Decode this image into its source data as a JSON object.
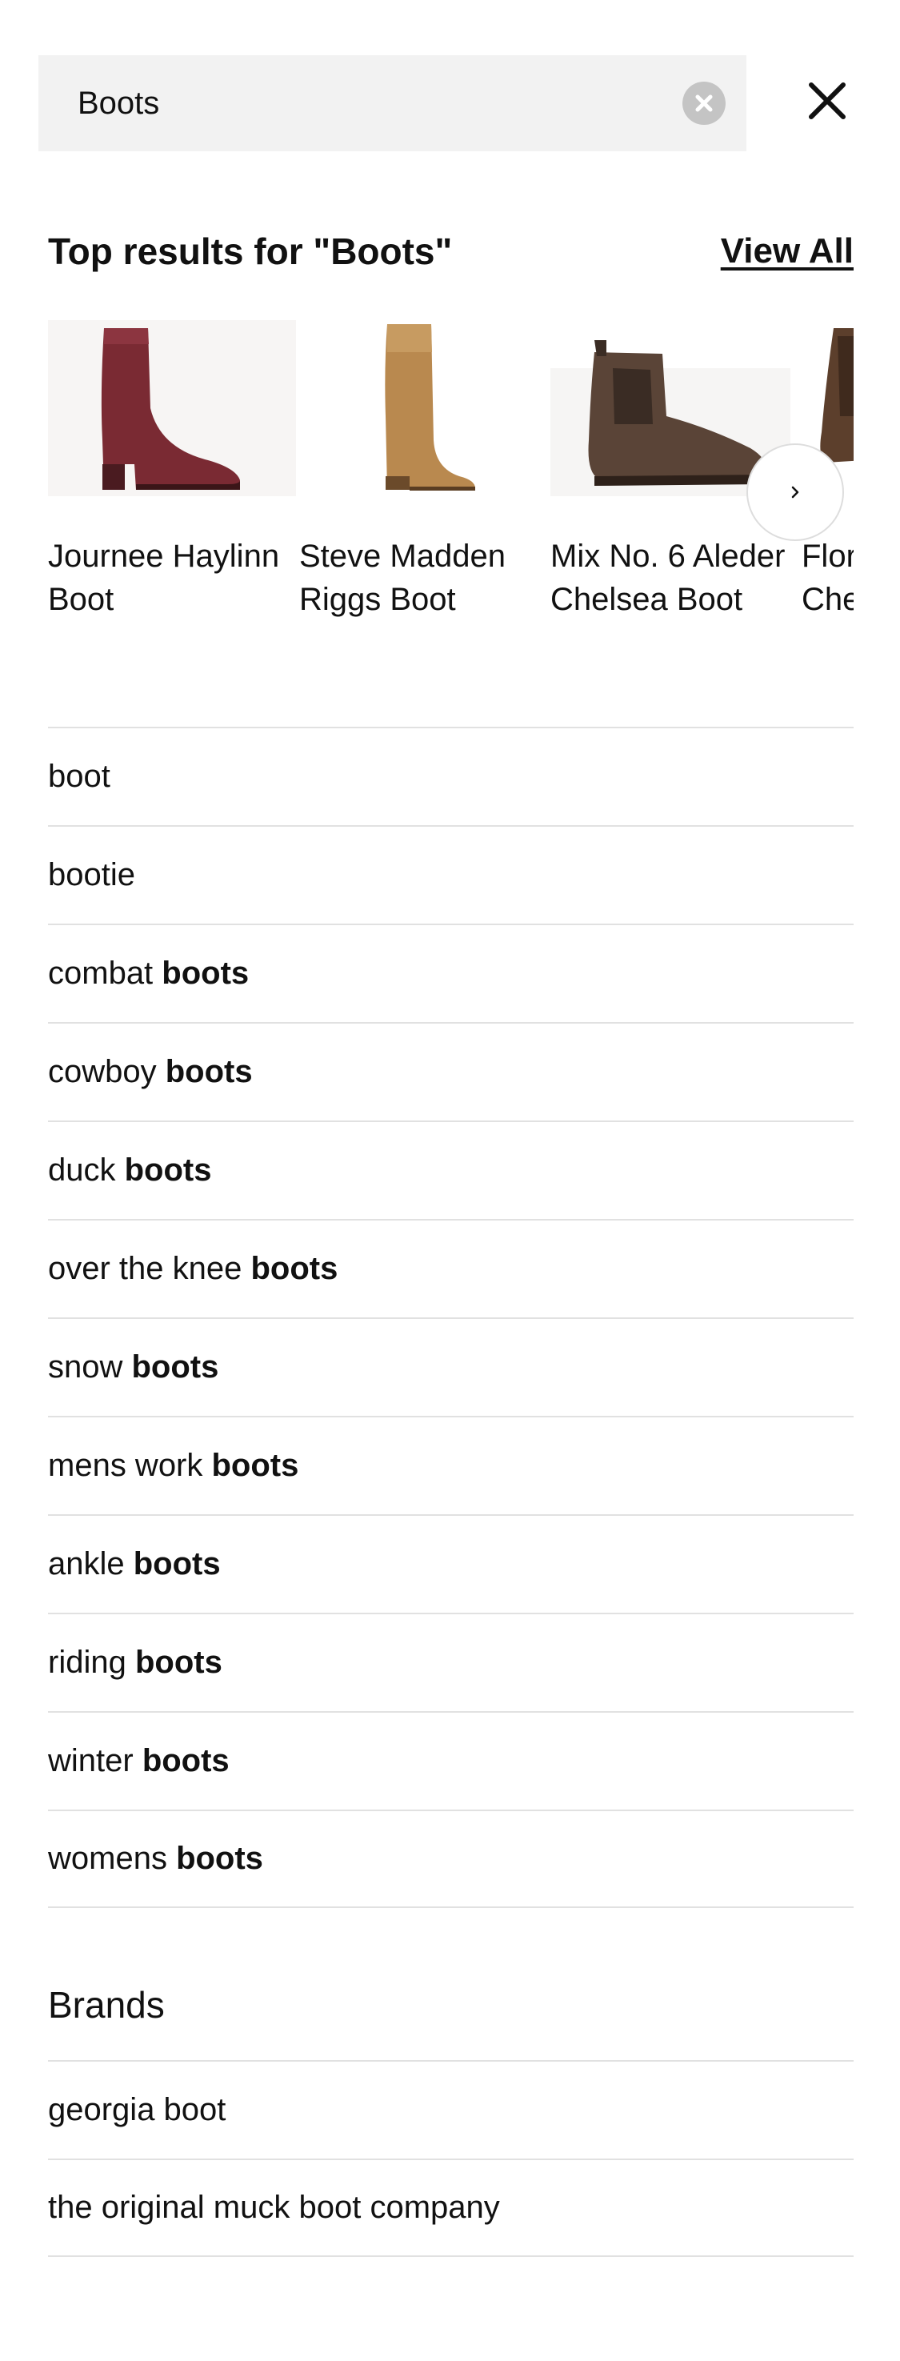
{
  "search": {
    "value": "Boots",
    "clear_icon": "clear-circle-icon",
    "close_icon": "close-x-icon"
  },
  "results": {
    "title": "Top results for \"Boots\"",
    "view_all_label": "View All",
    "products": [
      {
        "name": "Journee Haylinn Boot",
        "image": "burgundy ankle boot"
      },
      {
        "name": "Steve Madden Riggs Boot",
        "image": "tan tall riding boot"
      },
      {
        "name": "Mix No. 6 Aleder Chelsea Boot",
        "image": "brown chelsea boot"
      },
      {
        "name": "Florsheim Chelsea",
        "image": "brown boot partially visible"
      }
    ],
    "next_icon": "chevron-right-icon"
  },
  "suggestions": [
    {
      "plain": "boot",
      "bold": ""
    },
    {
      "plain": "bootie",
      "bold": ""
    },
    {
      "plain": "combat ",
      "bold": "boots"
    },
    {
      "plain": "cowboy ",
      "bold": "boots"
    },
    {
      "plain": "duck ",
      "bold": "boots"
    },
    {
      "plain": "over the knee ",
      "bold": "boots"
    },
    {
      "plain": "snow ",
      "bold": "boots"
    },
    {
      "plain": "mens work ",
      "bold": "boots"
    },
    {
      "plain": "ankle ",
      "bold": "boots"
    },
    {
      "plain": "riding ",
      "bold": "boots"
    },
    {
      "plain": "winter ",
      "bold": "boots"
    },
    {
      "plain": "womens ",
      "bold": "boots"
    }
  ],
  "brands": {
    "title": "Brands",
    "items": [
      "georgia boot",
      "the original muck boot company"
    ]
  }
}
